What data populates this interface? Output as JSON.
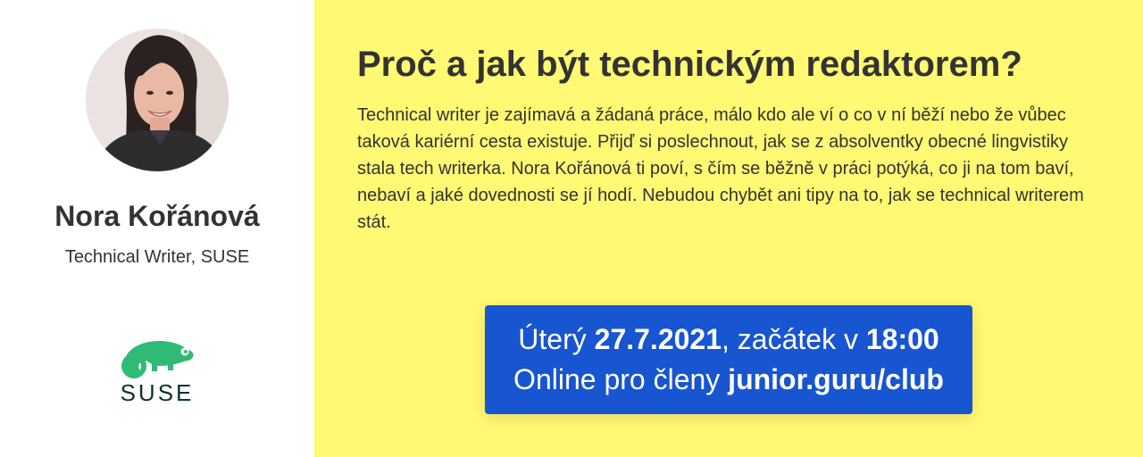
{
  "speaker": {
    "name": "Nora Kořánová",
    "role": "Technical Writer, SUSE"
  },
  "logo": {
    "text": "SUSE",
    "color": "#30ba78"
  },
  "event": {
    "title": "Proč a jak být technickým redaktorem?",
    "description": "Technical writer je zajímavá a žádaná práce, málo kdo ale ví o co v ní běží nebo že vůbec taková kariérní cesta existuje. Přijď si poslechnout, jak se z absolventky obecné lingvistiky stala tech writerka. Nora Kořánová ti poví, s čím se běžně v práci potýká, co ji na tom baví, nebaví a jaké dovednosti se jí hodí. Nebudou chybět ani tipy na to, jak se technical writerem stát.",
    "day": "Úterý ",
    "date": "27.7.2021",
    "start_prefix": ", začátek v ",
    "time": "18:00",
    "online_prefix": "Online pro členy ",
    "link": "junior.guru/club"
  },
  "colors": {
    "accent_yellow": "#fff973",
    "button_blue": "#1755d1",
    "text_dark": "#333333"
  }
}
